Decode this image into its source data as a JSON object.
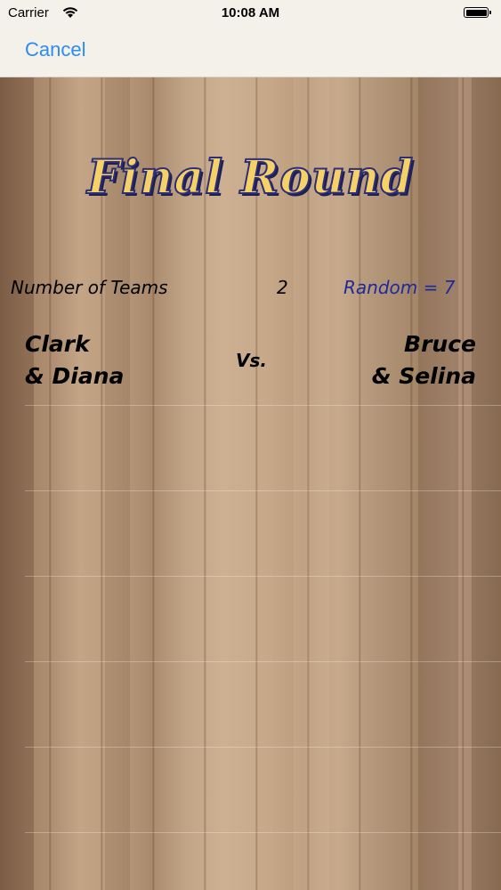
{
  "status_bar": {
    "carrier": "Carrier",
    "time": "10:08 AM"
  },
  "nav": {
    "cancel_label": "Cancel"
  },
  "main": {
    "title": "Final Round",
    "teams_label": "Number of Teams",
    "teams_count": "2",
    "random_label": "Random = 7",
    "matchup": {
      "left_team": [
        "Clark",
        "& Diana"
      ],
      "vs_label": "Vs.",
      "right_team": [
        "Bruce",
        "& Selina"
      ]
    }
  },
  "colors": {
    "accent": "#2b8cf3",
    "title_fill": "#f6d166",
    "title_outline": "#2c2f78",
    "random_text": "#1f2a9a"
  }
}
